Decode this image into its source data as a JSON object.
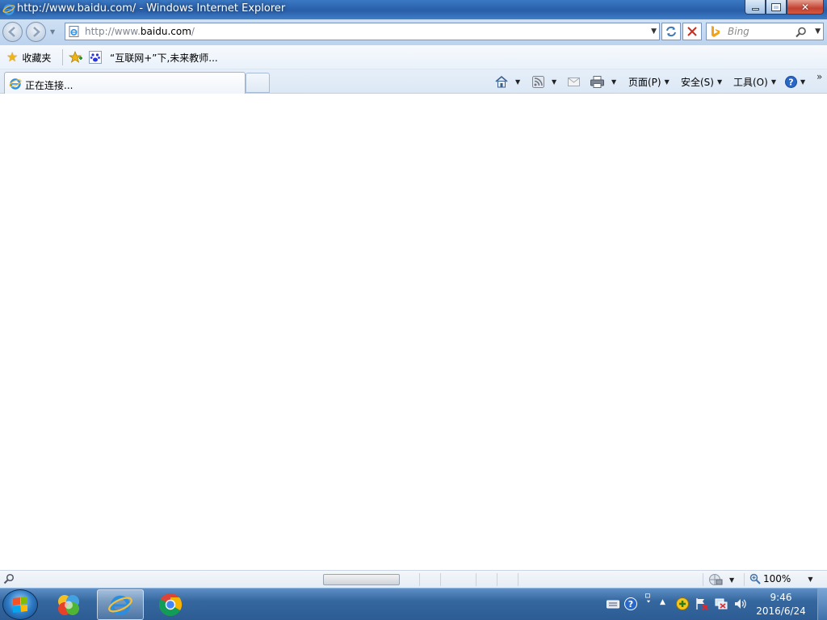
{
  "window": {
    "title": "http://www.baidu.com/ - Windows Internet Explorer",
    "close_symbol": "✕"
  },
  "address_bar": {
    "url_prefix": "http://www.",
    "url_domain": "baidu.com",
    "url_suffix": "/"
  },
  "search_box": {
    "placeholder": "Bing"
  },
  "favorites_bar": {
    "favorites_label": "收藏夹",
    "items": [
      {
        "label": "“互联网+”下,未来教师..."
      }
    ]
  },
  "tabs": [
    {
      "label": "正在连接..."
    }
  ],
  "command_bar": {
    "page_label": "页面(P)",
    "safety_label": "安全(S)",
    "tools_label": "工具(O)",
    "overflow_label": "»"
  },
  "status_bar": {
    "zoom": "100%"
  },
  "taskbar": {
    "time": "9:46",
    "date": "2016/6/24"
  },
  "colors": {
    "titlebar": "#2c62ad",
    "taskbar": "#35679f",
    "accent": "#3e79b6"
  }
}
